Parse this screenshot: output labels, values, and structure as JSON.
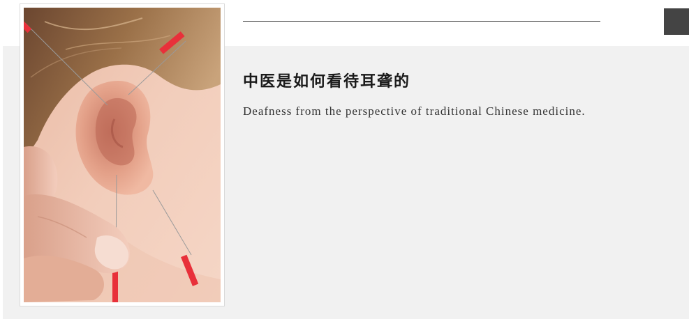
{
  "article": {
    "title": "中医是如何看待耳聋的",
    "subtitle": "Deafness from the perspective of traditional Chinese medicine."
  },
  "image": {
    "subject": "ear-acupuncture-photo"
  },
  "colors": {
    "panel_background": "#f1f1f1",
    "corner_button": "#444444",
    "rule": "#444444",
    "needle_handle": "#e8303a"
  }
}
